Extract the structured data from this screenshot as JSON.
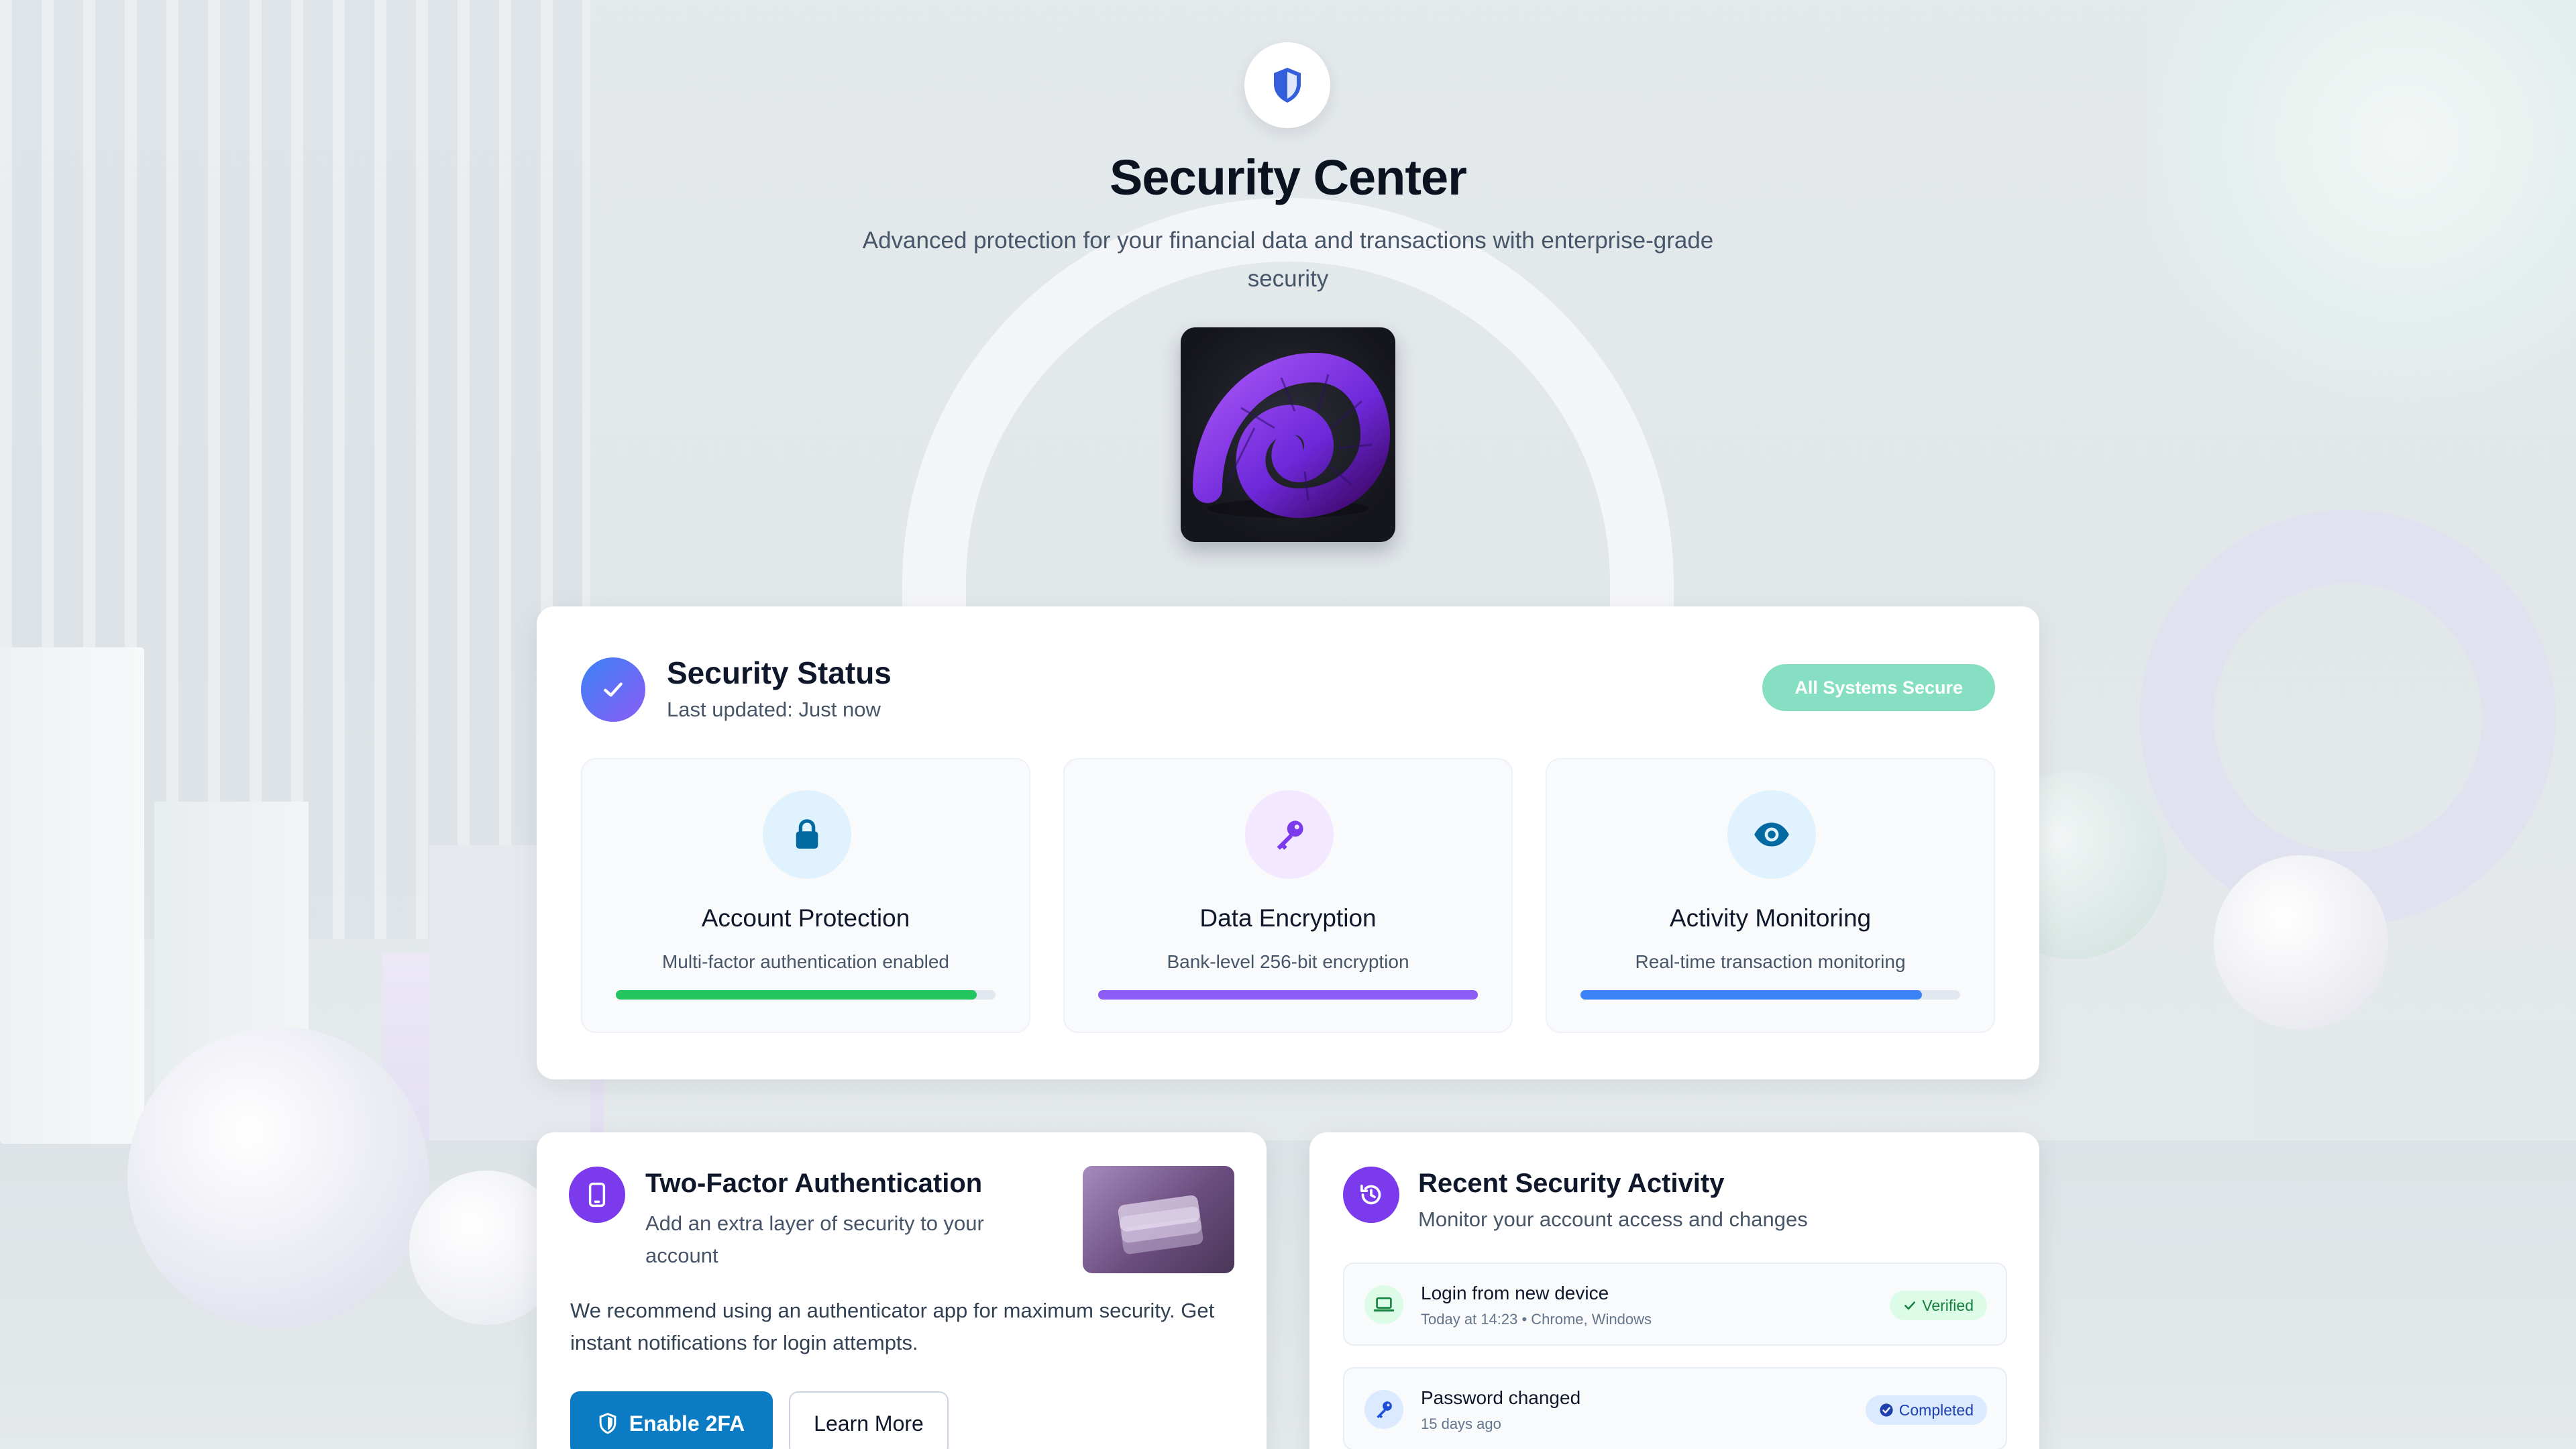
{
  "header": {
    "title": "Security Center",
    "subtitle": "Advanced protection for your financial data and transactions with enterprise-grade security",
    "shield_icon": "shield-icon",
    "hero_image": "purple-spiral-shell-artwork"
  },
  "status": {
    "title": "Security Status",
    "updated": "Last updated: Just now",
    "badge": "All Systems Secure",
    "features": [
      {
        "title": "Account Protection",
        "desc": "Multi-factor authentication enabled",
        "icon": "lock-icon",
        "color": "#22c55e",
        "progress": 0.95
      },
      {
        "title": "Data Encryption",
        "desc": "Bank-level 256-bit encryption",
        "icon": "key-icon",
        "color": "#8b5cf6",
        "progress": 1.0
      },
      {
        "title": "Activity Monitoring",
        "desc": "Real-time transaction monitoring",
        "icon": "eye-icon",
        "color": "#3b82f6",
        "progress": 0.9
      }
    ]
  },
  "twofa": {
    "title": "Two-Factor Authentication",
    "subtitle": "Add an extra layer of security to your account",
    "body": "We recommend using an authenticator app for maximum security. Get instant notifications for login attempts.",
    "enable_label": "Enable 2FA",
    "learn_label": "Learn More"
  },
  "activity": {
    "title": "Recent Security Activity",
    "subtitle": "Monitor your account access and changes",
    "items": [
      {
        "title": "Login from new device",
        "meta": "Today at 14:23 • Chrome, Windows",
        "badge": "Verified",
        "icon": "laptop-icon"
      },
      {
        "title": "Password changed",
        "meta": "15 days ago",
        "badge": "Completed",
        "icon": "key-icon"
      }
    ]
  }
}
